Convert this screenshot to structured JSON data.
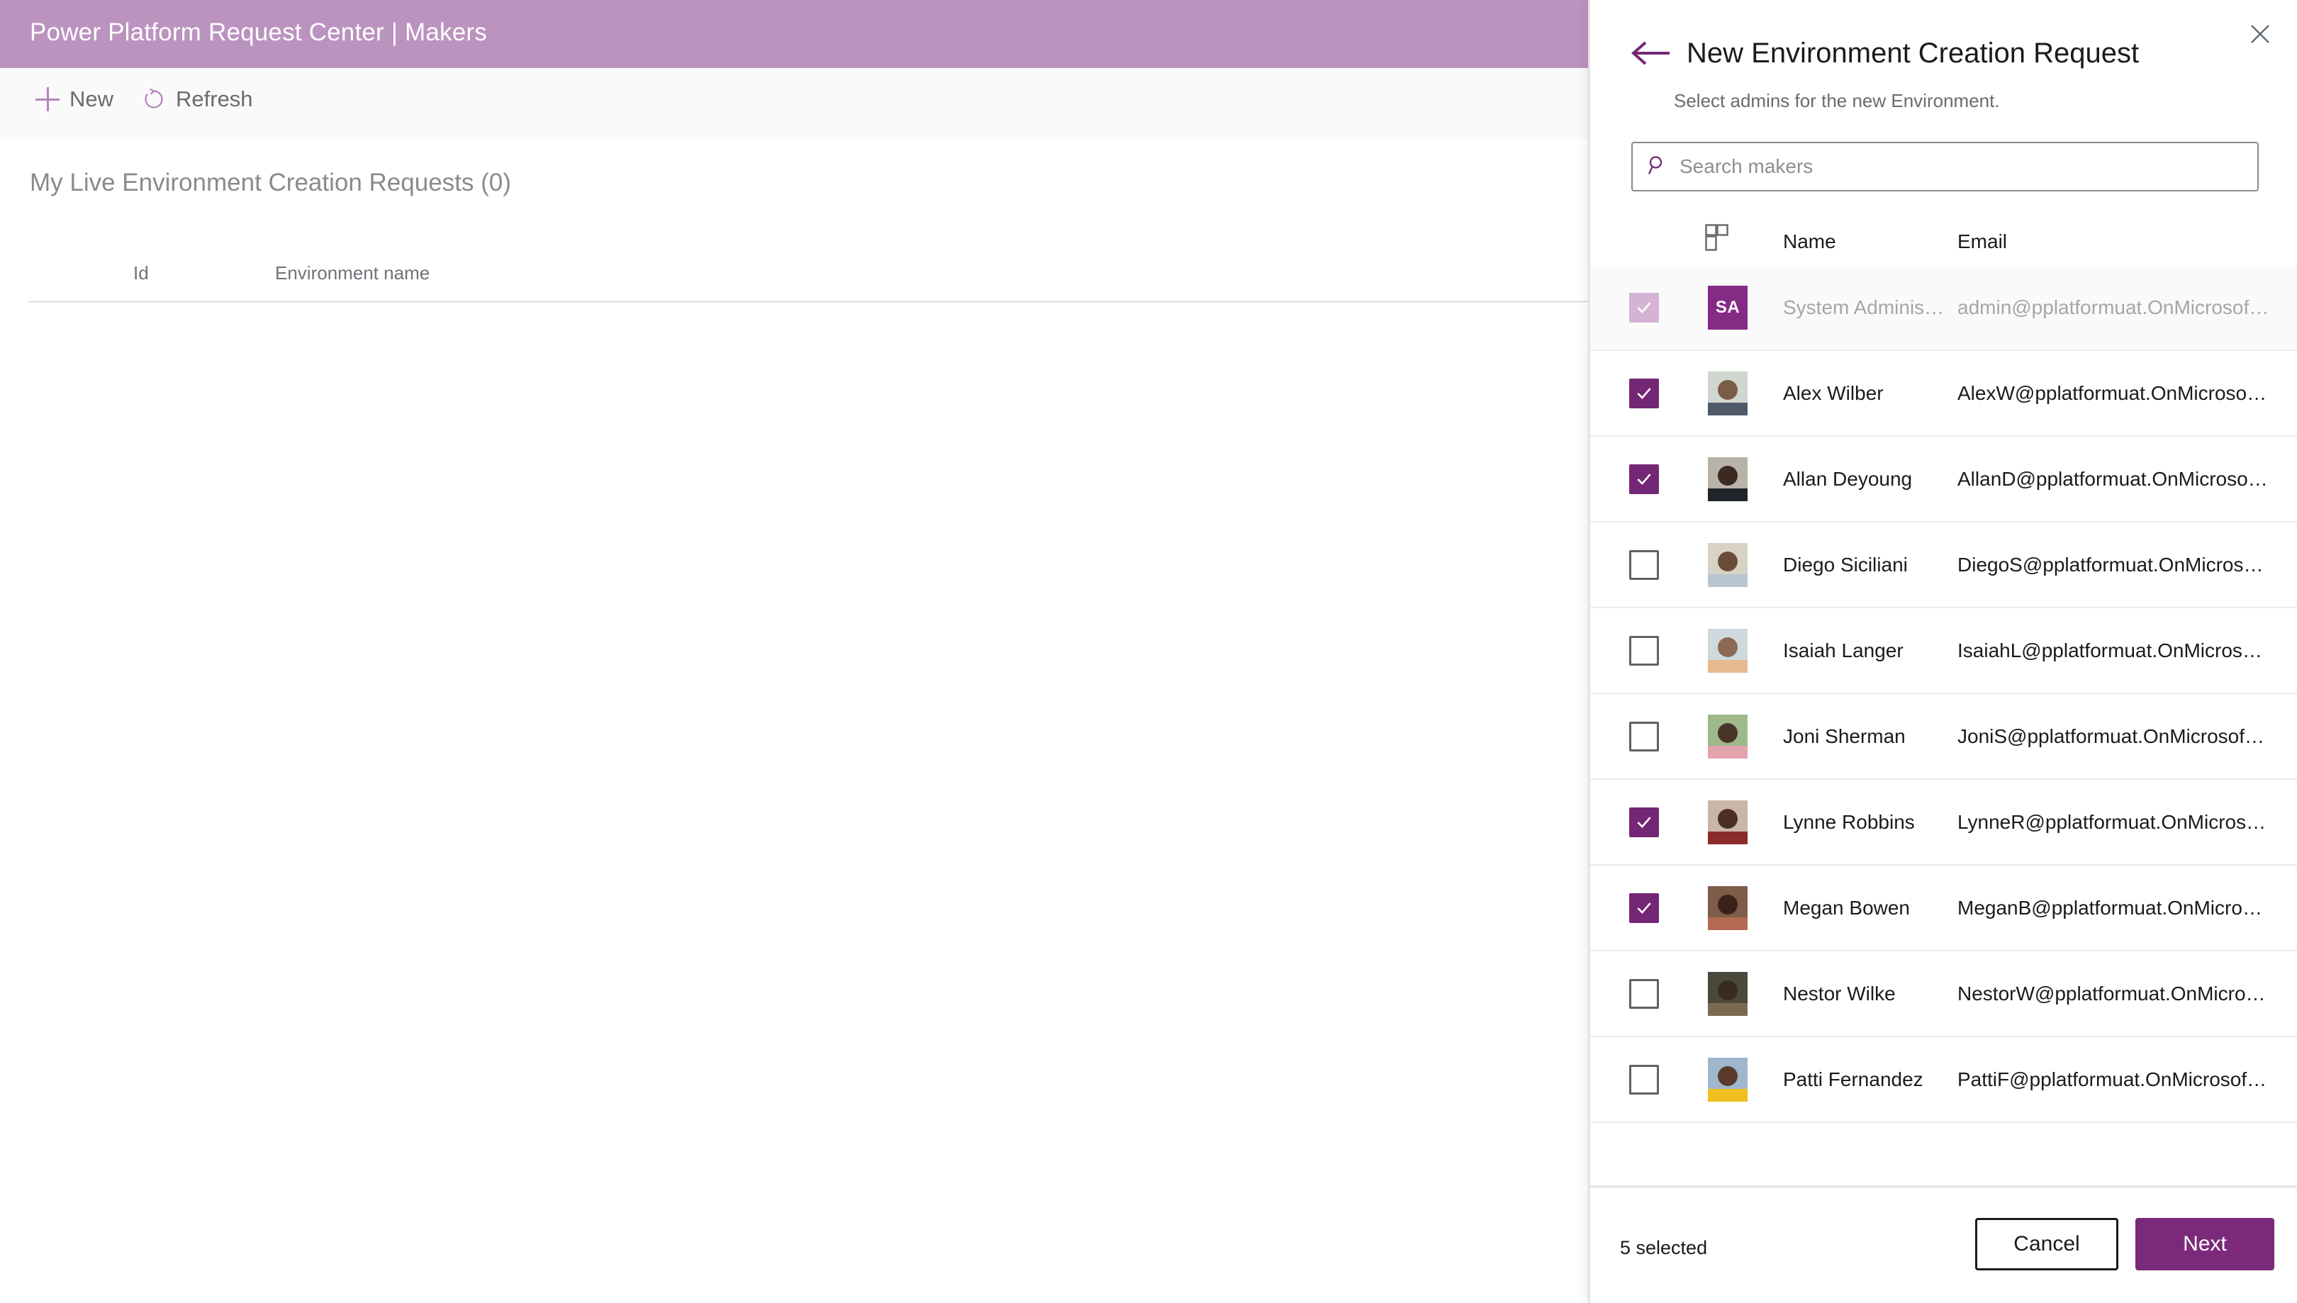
{
  "colors": {
    "header_bar": "#bb93bf",
    "accent_purple": "#742774",
    "primary_button": "#7b2a7b",
    "avatar_initials_bg": "#852b85",
    "muted_checkbox": "#d4b3d4"
  },
  "app": {
    "title": "Power Platform Request Center | Makers",
    "toolbar": {
      "new_label": "New",
      "new_icon": "plus-icon",
      "refresh_label": "Refresh",
      "refresh_icon": "refresh-icon"
    },
    "list": {
      "title": "My Live Environment Creation Requests (0)",
      "columns": [
        "Id",
        "Environment name"
      ],
      "rows": []
    }
  },
  "panel": {
    "back_icon": "back-arrow-icon",
    "close_icon": "close-icon",
    "title": "New Environment Creation Request",
    "subtitle": "Select admins for the new Environment.",
    "search": {
      "icon": "search-icon",
      "placeholder": "Search makers",
      "value": ""
    },
    "grid": {
      "photo_column_icon": "thumbnail-column-icon",
      "columns": [
        "Name",
        "Email"
      ],
      "rows": [
        {
          "name": "System Administr...",
          "email": "admin@pplatformuat.OnMicrosoft.co...",
          "checked": true,
          "disabled": true,
          "avatar_type": "initials",
          "initials": "SA"
        },
        {
          "name": "Alex Wilber",
          "email": "AlexW@pplatformuat.OnMicrosoft.c...",
          "checked": true,
          "disabled": false,
          "avatar_type": "photo",
          "avatar_key": "alex"
        },
        {
          "name": "Allan Deyoung",
          "email": "AllanD@pplatformuat.OnMicrosoft.c...",
          "checked": true,
          "disabled": false,
          "avatar_type": "photo",
          "avatar_key": "allan"
        },
        {
          "name": "Diego Siciliani",
          "email": "DiegoS@pplatformuat.OnMicrosoft.c...",
          "checked": false,
          "disabled": false,
          "avatar_type": "photo",
          "avatar_key": "diego"
        },
        {
          "name": "Isaiah Langer",
          "email": "IsaiahL@pplatformuat.OnMicrosoft.c...",
          "checked": false,
          "disabled": false,
          "avatar_type": "photo",
          "avatar_key": "isaiah"
        },
        {
          "name": "Joni Sherman",
          "email": "JoniS@pplatformuat.OnMicrosoft.com",
          "checked": false,
          "disabled": false,
          "avatar_type": "photo",
          "avatar_key": "joni"
        },
        {
          "name": "Lynne Robbins",
          "email": "LynneR@pplatformuat.OnMicrosoft.c...",
          "checked": true,
          "disabled": false,
          "avatar_type": "photo",
          "avatar_key": "lynne"
        },
        {
          "name": "Megan Bowen",
          "email": "MeganB@pplatformuat.OnMicrosoft....",
          "checked": true,
          "disabled": false,
          "avatar_type": "photo",
          "avatar_key": "megan"
        },
        {
          "name": "Nestor Wilke",
          "email": "NestorW@pplatformuat.OnMicrosoft...",
          "checked": false,
          "disabled": false,
          "avatar_type": "photo",
          "avatar_key": "nestor"
        },
        {
          "name": "Patti Fernandez",
          "email": "PattiF@pplatformuat.OnMicrosoft.com",
          "checked": false,
          "disabled": false,
          "avatar_type": "photo",
          "avatar_key": "patti"
        }
      ]
    },
    "footer": {
      "selected_text": "5 selected",
      "cancel_label": "Cancel",
      "next_label": "Next"
    }
  }
}
